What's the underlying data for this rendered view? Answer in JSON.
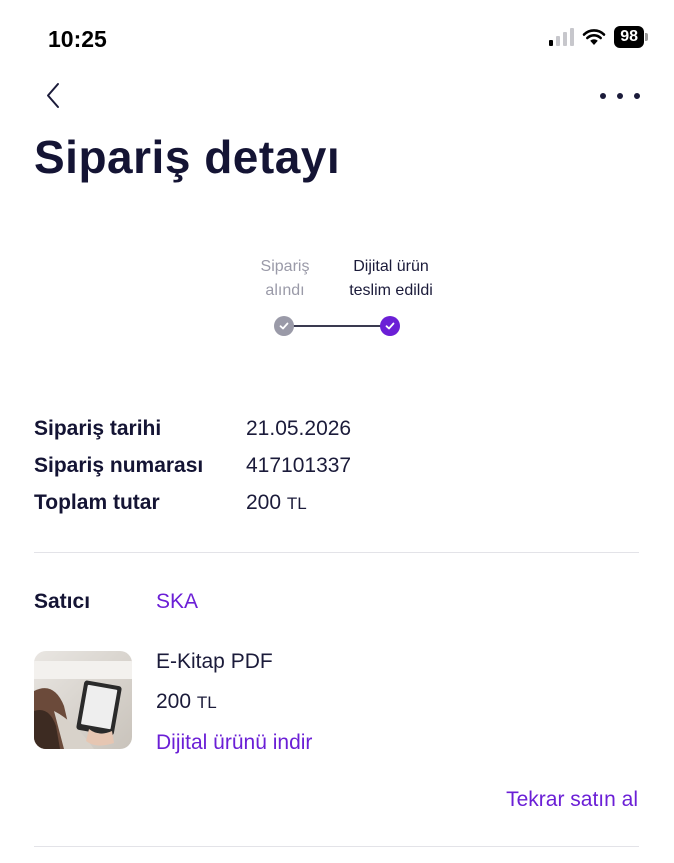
{
  "status_bar": {
    "time": "10:25",
    "battery": "98",
    "signal_icon": "cellular-signal-icon",
    "wifi_icon": "wifi-icon",
    "battery_icon": "battery-icon"
  },
  "nav": {
    "back_icon": "chevron-left-icon",
    "more_icon": "more-horizontal-icon"
  },
  "page": {
    "title": "Sipariş detayı"
  },
  "stepper": {
    "steps": [
      {
        "label": "Sipariş\nalındı",
        "status": "done",
        "color": "#9a9aa8",
        "icon": "check-icon"
      },
      {
        "label": "Dijital ürün\nteslim edildi",
        "status": "current",
        "color": "#6b1fd6",
        "icon": "check-icon"
      }
    ]
  },
  "order": {
    "date_label": "Sipariş tarihi",
    "date_value": "21.05.2026",
    "number_label": "Sipariş numarası",
    "number_value": "417101337",
    "total_label": "Toplam tutar",
    "total_amount": "200",
    "total_currency": "TL"
  },
  "seller": {
    "label": "Satıcı",
    "name": "SKA"
  },
  "product": {
    "name": "E-Kitap PDF",
    "price_amount": "200",
    "price_currency": "TL",
    "download_label": "Dijital ürünü indir",
    "thumbnail_icon": "ebook-reader-thumbnail"
  },
  "actions": {
    "rebuy_label": "Tekrar satın al"
  },
  "colors": {
    "accent": "#6b1fd6",
    "text_primary": "#141434",
    "muted": "#9a9aa8",
    "divider": "#e3e3e8"
  }
}
